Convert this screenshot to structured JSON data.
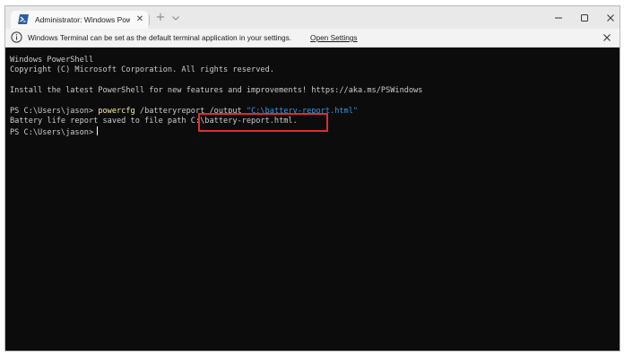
{
  "window": {
    "tab_title": "Administrator: Windows PowerS",
    "tab_close_glyph": "✕",
    "new_tab_glyph": "+",
    "icons": {
      "tab": "powershell-icon",
      "dropdown": "chevron-down-icon",
      "minimize": "minimize-icon",
      "maximize": "maximize-icon",
      "close": "close-icon"
    }
  },
  "infobar": {
    "message": "Windows Terminal can be set as the default terminal application in your settings.",
    "link_label": "Open Settings",
    "icon": "info-icon",
    "close_icon": "close-icon"
  },
  "terminal": {
    "header_line1": "Windows PowerShell",
    "header_line2": "Copyright (C) Microsoft Corporation. All rights reserved.",
    "install_line": "Install the latest PowerShell for new features and improvements! https://aka.ms/PSWindows",
    "prompt1": "PS C:\\Users\\jason> ",
    "command": "powercfg",
    "command_args": " /batteryreport /output ",
    "command_path": "\"C:\\battery-report.html\"",
    "output_prefix": "Battery life report saved to file path ",
    "output_path": "C:\\battery-report.html.",
    "prompt2": "PS C:\\Users\\jason>"
  },
  "colors": {
    "terminal_bg": "#0c0c0c",
    "terminal_fg": "#cccccc",
    "command": "#f9f1a5",
    "string": "#3a96dd",
    "highlight": "#d9302e"
  }
}
